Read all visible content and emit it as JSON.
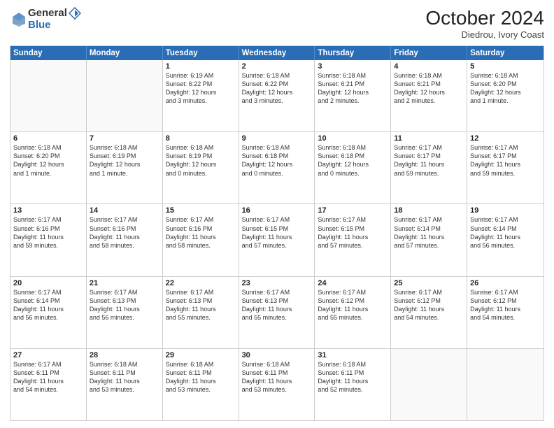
{
  "logo": {
    "general": "General",
    "blue": "Blue"
  },
  "header": {
    "month": "October 2024",
    "location": "Diedrou, Ivory Coast"
  },
  "days": [
    "Sunday",
    "Monday",
    "Tuesday",
    "Wednesday",
    "Thursday",
    "Friday",
    "Saturday"
  ],
  "weeks": [
    [
      {
        "day": "",
        "info": ""
      },
      {
        "day": "",
        "info": ""
      },
      {
        "day": "1",
        "info": "Sunrise: 6:19 AM\nSunset: 6:22 PM\nDaylight: 12 hours\nand 3 minutes."
      },
      {
        "day": "2",
        "info": "Sunrise: 6:18 AM\nSunset: 6:22 PM\nDaylight: 12 hours\nand 3 minutes."
      },
      {
        "day": "3",
        "info": "Sunrise: 6:18 AM\nSunset: 6:21 PM\nDaylight: 12 hours\nand 2 minutes."
      },
      {
        "day": "4",
        "info": "Sunrise: 6:18 AM\nSunset: 6:21 PM\nDaylight: 12 hours\nand 2 minutes."
      },
      {
        "day": "5",
        "info": "Sunrise: 6:18 AM\nSunset: 6:20 PM\nDaylight: 12 hours\nand 1 minute."
      }
    ],
    [
      {
        "day": "6",
        "info": "Sunrise: 6:18 AM\nSunset: 6:20 PM\nDaylight: 12 hours\nand 1 minute."
      },
      {
        "day": "7",
        "info": "Sunrise: 6:18 AM\nSunset: 6:19 PM\nDaylight: 12 hours\nand 1 minute."
      },
      {
        "day": "8",
        "info": "Sunrise: 6:18 AM\nSunset: 6:19 PM\nDaylight: 12 hours\nand 0 minutes."
      },
      {
        "day": "9",
        "info": "Sunrise: 6:18 AM\nSunset: 6:18 PM\nDaylight: 12 hours\nand 0 minutes."
      },
      {
        "day": "10",
        "info": "Sunrise: 6:18 AM\nSunset: 6:18 PM\nDaylight: 12 hours\nand 0 minutes."
      },
      {
        "day": "11",
        "info": "Sunrise: 6:17 AM\nSunset: 6:17 PM\nDaylight: 11 hours\nand 59 minutes."
      },
      {
        "day": "12",
        "info": "Sunrise: 6:17 AM\nSunset: 6:17 PM\nDaylight: 11 hours\nand 59 minutes."
      }
    ],
    [
      {
        "day": "13",
        "info": "Sunrise: 6:17 AM\nSunset: 6:16 PM\nDaylight: 11 hours\nand 59 minutes."
      },
      {
        "day": "14",
        "info": "Sunrise: 6:17 AM\nSunset: 6:16 PM\nDaylight: 11 hours\nand 58 minutes."
      },
      {
        "day": "15",
        "info": "Sunrise: 6:17 AM\nSunset: 6:16 PM\nDaylight: 11 hours\nand 58 minutes."
      },
      {
        "day": "16",
        "info": "Sunrise: 6:17 AM\nSunset: 6:15 PM\nDaylight: 11 hours\nand 57 minutes."
      },
      {
        "day": "17",
        "info": "Sunrise: 6:17 AM\nSunset: 6:15 PM\nDaylight: 11 hours\nand 57 minutes."
      },
      {
        "day": "18",
        "info": "Sunrise: 6:17 AM\nSunset: 6:14 PM\nDaylight: 11 hours\nand 57 minutes."
      },
      {
        "day": "19",
        "info": "Sunrise: 6:17 AM\nSunset: 6:14 PM\nDaylight: 11 hours\nand 56 minutes."
      }
    ],
    [
      {
        "day": "20",
        "info": "Sunrise: 6:17 AM\nSunset: 6:14 PM\nDaylight: 11 hours\nand 56 minutes."
      },
      {
        "day": "21",
        "info": "Sunrise: 6:17 AM\nSunset: 6:13 PM\nDaylight: 11 hours\nand 56 minutes."
      },
      {
        "day": "22",
        "info": "Sunrise: 6:17 AM\nSunset: 6:13 PM\nDaylight: 11 hours\nand 55 minutes."
      },
      {
        "day": "23",
        "info": "Sunrise: 6:17 AM\nSunset: 6:13 PM\nDaylight: 11 hours\nand 55 minutes."
      },
      {
        "day": "24",
        "info": "Sunrise: 6:17 AM\nSunset: 6:12 PM\nDaylight: 11 hours\nand 55 minutes."
      },
      {
        "day": "25",
        "info": "Sunrise: 6:17 AM\nSunset: 6:12 PM\nDaylight: 11 hours\nand 54 minutes."
      },
      {
        "day": "26",
        "info": "Sunrise: 6:17 AM\nSunset: 6:12 PM\nDaylight: 11 hours\nand 54 minutes."
      }
    ],
    [
      {
        "day": "27",
        "info": "Sunrise: 6:17 AM\nSunset: 6:11 PM\nDaylight: 11 hours\nand 54 minutes."
      },
      {
        "day": "28",
        "info": "Sunrise: 6:18 AM\nSunset: 6:11 PM\nDaylight: 11 hours\nand 53 minutes."
      },
      {
        "day": "29",
        "info": "Sunrise: 6:18 AM\nSunset: 6:11 PM\nDaylight: 11 hours\nand 53 minutes."
      },
      {
        "day": "30",
        "info": "Sunrise: 6:18 AM\nSunset: 6:11 PM\nDaylight: 11 hours\nand 53 minutes."
      },
      {
        "day": "31",
        "info": "Sunrise: 6:18 AM\nSunset: 6:11 PM\nDaylight: 11 hours\nand 52 minutes."
      },
      {
        "day": "",
        "info": ""
      },
      {
        "day": "",
        "info": ""
      }
    ]
  ]
}
